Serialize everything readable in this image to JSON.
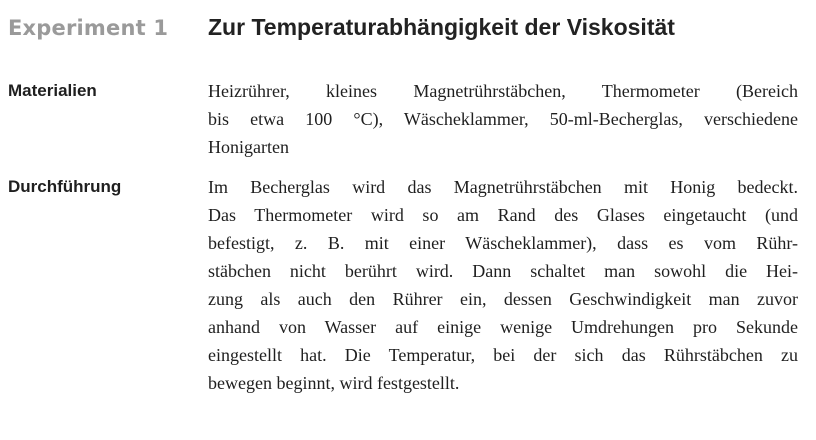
{
  "header": {
    "experiment_label": "Experiment 1",
    "title": "Zur Temperaturabhängigkeit der Viskosität"
  },
  "sections": [
    {
      "label": "Materialien",
      "lines": [
        "Heizrührer, kleines Magnetrührstäbchen, Thermometer (Bereich",
        "bis etwa 100 °C), Wäscheklammer, 50-ml-Becherglas, verschiedene",
        "Honigarten"
      ]
    },
    {
      "label": "Durchführung",
      "lines": [
        "Im Becherglas wird das Magnetrührstäbchen mit Honig bedeckt.",
        "Das Thermometer wird so am Rand des Glases eingetaucht (und",
        "befestigt, z. B. mit einer Wäscheklammer), dass es vom Rühr-",
        "stäbchen nicht berührt wird. Dann schaltet man sowohl die Hei-",
        "zung als auch den Rührer ein, dessen Geschwindigkeit man zuvor",
        "anhand von Wasser auf einige wenige Umdrehungen pro Sekunde",
        "eingestellt hat. Die Temperatur, bei der sich das Rührstäbchen zu",
        "bewegen beginnt, wird festgestellt."
      ]
    }
  ]
}
